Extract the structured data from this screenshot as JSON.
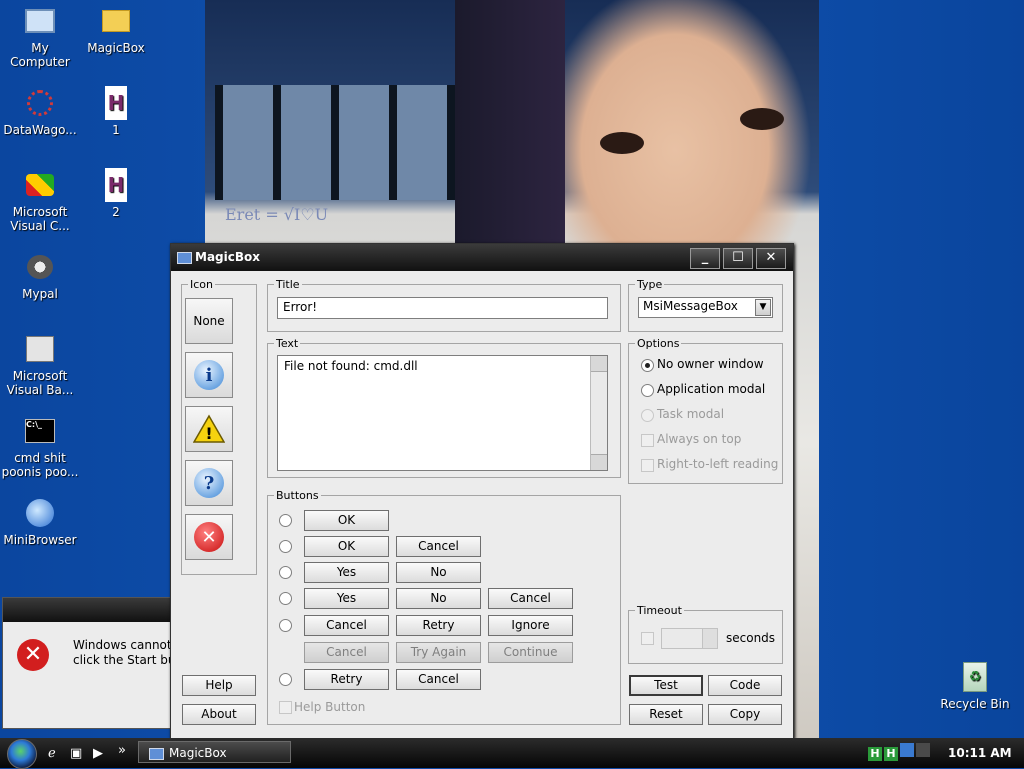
{
  "desktop_icons": [
    {
      "label": "My Computer"
    },
    {
      "label": "MagicBox"
    },
    {
      "label": "DataWago..."
    },
    {
      "label": "1",
      "glyph": "H"
    },
    {
      "label": "Microsoft Visual C..."
    },
    {
      "label": "2",
      "glyph": "H"
    },
    {
      "label": "Mypal"
    },
    {
      "label": "Microsoft Visual Ba..."
    },
    {
      "label": "cmd shit poonis poo..."
    },
    {
      "label": "MiniBrowser"
    },
    {
      "label": "Recycle Bin"
    }
  ],
  "photo_scribble": "Eret = √I♡U",
  "message_box": {
    "line1": "Windows cannot f",
    "line2": "click the Start butt",
    "icon": "error-icon"
  },
  "dialog": {
    "title": "MagicBox",
    "window_controls": {
      "minimize": "_",
      "maximize": "☐",
      "close": "✕"
    },
    "icon_group": {
      "legend": "Icon",
      "none_label": "None"
    },
    "title_group": {
      "legend": "Title",
      "value": "Error!"
    },
    "text_group": {
      "legend": "Text",
      "value": "File not found: cmd.dll"
    },
    "type_group": {
      "legend": "Type",
      "selected": "MsiMessageBox"
    },
    "options_group": {
      "legend": "Options",
      "items": [
        "No owner window",
        "Application modal",
        "Task modal",
        "Always on top",
        "Right-to-left reading"
      ]
    },
    "buttons_group": {
      "legend": "Buttons",
      "rows": [
        [
          "OK"
        ],
        [
          "OK",
          "Cancel"
        ],
        [
          "Yes",
          "No"
        ],
        [
          "Yes",
          "No",
          "Cancel"
        ],
        [
          "Cancel",
          "Retry",
          "Ignore"
        ],
        [
          "Cancel",
          "Try Again",
          "Continue"
        ],
        [
          "Retry",
          "Cancel"
        ]
      ],
      "help_checkbox": "Help Button"
    },
    "timeout_group": {
      "legend": "Timeout",
      "unit": "seconds"
    },
    "bottom_buttons": {
      "help": "Help",
      "about": "About",
      "test": "Test",
      "code": "Code",
      "reset": "Reset",
      "copy": "Copy"
    }
  },
  "taskbar": {
    "task_label": "MagicBox",
    "clock": "10:11 AM",
    "quicklaunch_more": "»"
  }
}
